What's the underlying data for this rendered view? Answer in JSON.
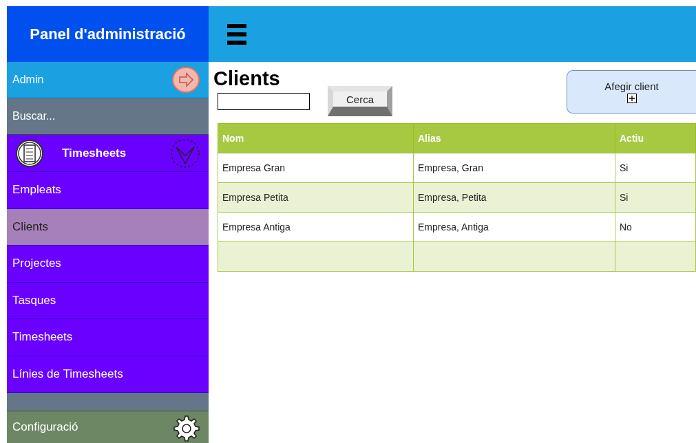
{
  "sidebar": {
    "title": "Panel d'administració",
    "user": {
      "name": "Admin"
    },
    "search": {
      "placeholder": "Buscar..."
    },
    "section": {
      "label": "Timesheets",
      "expanded": true
    },
    "items": [
      {
        "label": "Empleats",
        "selected": false
      },
      {
        "label": "Clients",
        "selected": true
      },
      {
        "label": "Projectes",
        "selected": false
      },
      {
        "label": "Tasques",
        "selected": false
      },
      {
        "label": "Timesheets",
        "selected": false
      },
      {
        "label": "Línies de Timesheets",
        "selected": false
      }
    ],
    "settings": {
      "label": "Configuració"
    }
  },
  "page": {
    "title": "Clients",
    "search_button": "Cerca",
    "add_button": "Afegir client"
  },
  "table": {
    "columns": [
      "Nom",
      "Alias",
      "Actiu"
    ],
    "rows": [
      [
        "Empresa Gran",
        "Empresa, Gran",
        "Si"
      ],
      [
        "Empresa Petita",
        "Empresa, Petita",
        "Si"
      ],
      [
        "Empresa Antiga",
        "Empresa, Antiga",
        "No"
      ]
    ]
  }
}
